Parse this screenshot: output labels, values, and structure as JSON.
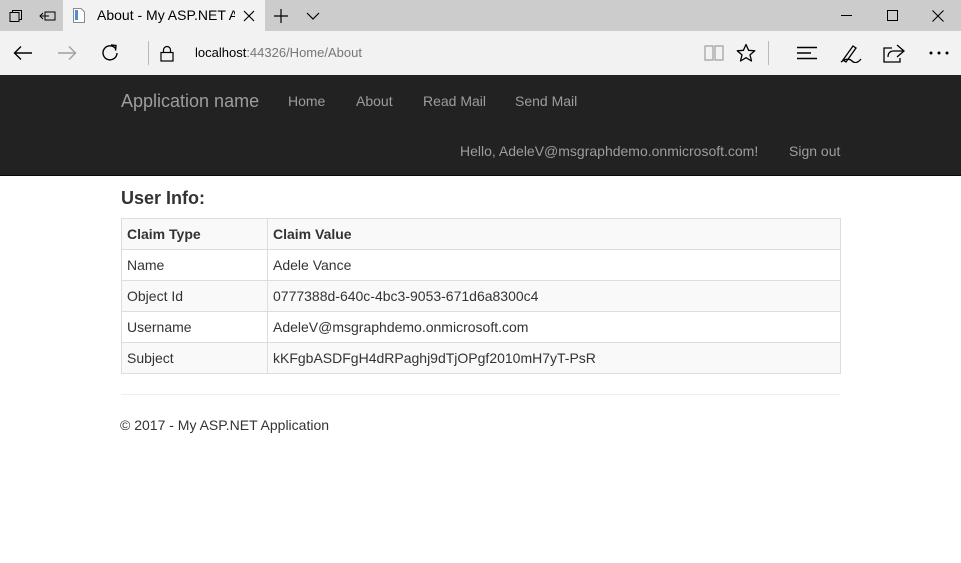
{
  "browser": {
    "tab": {
      "title": "About - My ASP.NET Ap"
    },
    "address": {
      "host": "localhost",
      "rest": ":44326/Home/About"
    }
  },
  "navbar": {
    "brand": "Application name",
    "links": [
      "Home",
      "About",
      "Read Mail",
      "Send Mail"
    ],
    "greeting": "Hello, AdeleV@msgraphdemo.onmicrosoft.com!",
    "signout": "Sign out"
  },
  "main": {
    "heading": "User Info:",
    "table": {
      "headers": [
        "Claim Type",
        "Claim Value"
      ],
      "rows": [
        [
          "Name",
          "Adele Vance"
        ],
        [
          "Object Id",
          "0777388d-640c-4bc3-9053-671d6a8300c4"
        ],
        [
          "Username",
          "AdeleV@msgraphdemo.onmicrosoft.com"
        ],
        [
          "Subject",
          "kKFgbASDFgH4dRPaghj9dTjOPgf2010mH7yT-PsR"
        ]
      ]
    }
  },
  "footer": {
    "text": "© 2017 - My ASP.NET Application"
  },
  "colors": {
    "navbar_bg": "#222222",
    "nav_text": "#9d9d9d",
    "chrome_bg": "#f2f2f2",
    "tabstrip_bg": "#cccccc"
  }
}
